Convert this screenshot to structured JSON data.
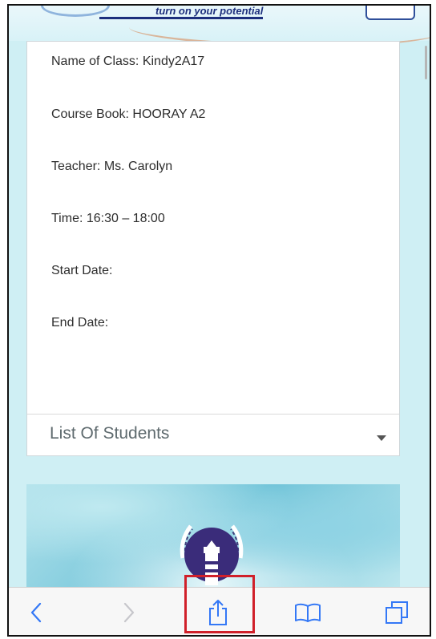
{
  "header": {
    "tagline": "turn on your potential"
  },
  "class_info": {
    "name": "Name of Class: Kindy2A17",
    "course_book": "Course Book: HOORAY A2",
    "teacher": "Teacher: Ms. Carolyn",
    "time": "Time: 16:30 – 18:00",
    "start_date": "Start Date:",
    "end_date": "End Date:"
  },
  "accordion": {
    "label": "List Of Students"
  },
  "toolbar": {
    "buttons": [
      {
        "icon": "back-arrow-icon"
      },
      {
        "icon": "forward-arrow-icon"
      },
      {
        "icon": "share-icon"
      },
      {
        "icon": "bookmarks-icon"
      },
      {
        "icon": "tabs-icon"
      }
    ]
  },
  "colors": {
    "page_background": "#cfeff4",
    "tagline_color": "#1d2f7d",
    "toolbar_icon": "#3478f6",
    "toolbar_icon_disabled": "#c7c7cc",
    "highlight": "#d0202a"
  }
}
